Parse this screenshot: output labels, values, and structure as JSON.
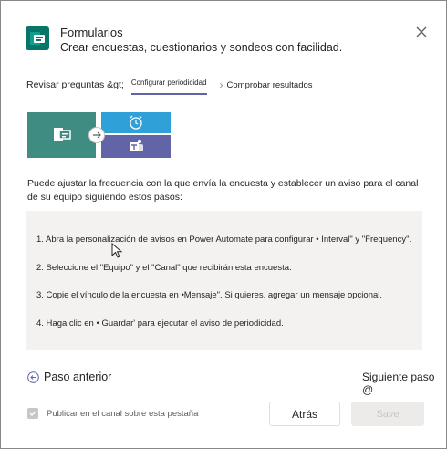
{
  "header": {
    "title": "Formularios",
    "subtitle": "Crear encuestas, cuestionarios y sondeos con facilidad."
  },
  "wizard": {
    "step1": "Revisar preguntas &gt;",
    "step2": "Configurar periodicidad",
    "step3": "Comprobar resultados"
  },
  "description": "Puede ajustar la frecuencia con la que envía la encuesta y establecer un aviso para el canal de su equipo siguiendo estos pasos:",
  "instructions": [
    "1. Abra la personalización de avisos en Power Automate para configurar • Interval\" y \"Frequency\".",
    "2. Seleccione el \"Equipo\" y el \"Canal\" que recibirán esta encuesta.",
    "3. Copie el vínculo de la encuesta en •Mensaje\". Si quieres. agregar un mensaje opcional.",
    "4. Haga clic en • Guardar' para ejecutar el aviso de periodicidad."
  ],
  "nav": {
    "previous": "Paso anterior",
    "next": "Siguiente paso @"
  },
  "footer": {
    "publish_label": "Publicar en el canal sobre esta pestaña",
    "publish_checked": true,
    "back_label": "Atrás",
    "save_label": "Save"
  },
  "colors": {
    "forms_green": "#077568",
    "teams_purple": "#6264a7",
    "blue": "#2fa0d8"
  },
  "icons": [
    "forms-app-icon",
    "close-icon",
    "chevron-right-icon",
    "forms-icon",
    "arrow-right-icon",
    "alarm-icon",
    "teams-icon",
    "arrow-left-circle-icon",
    "mouse-cursor-icon"
  ]
}
